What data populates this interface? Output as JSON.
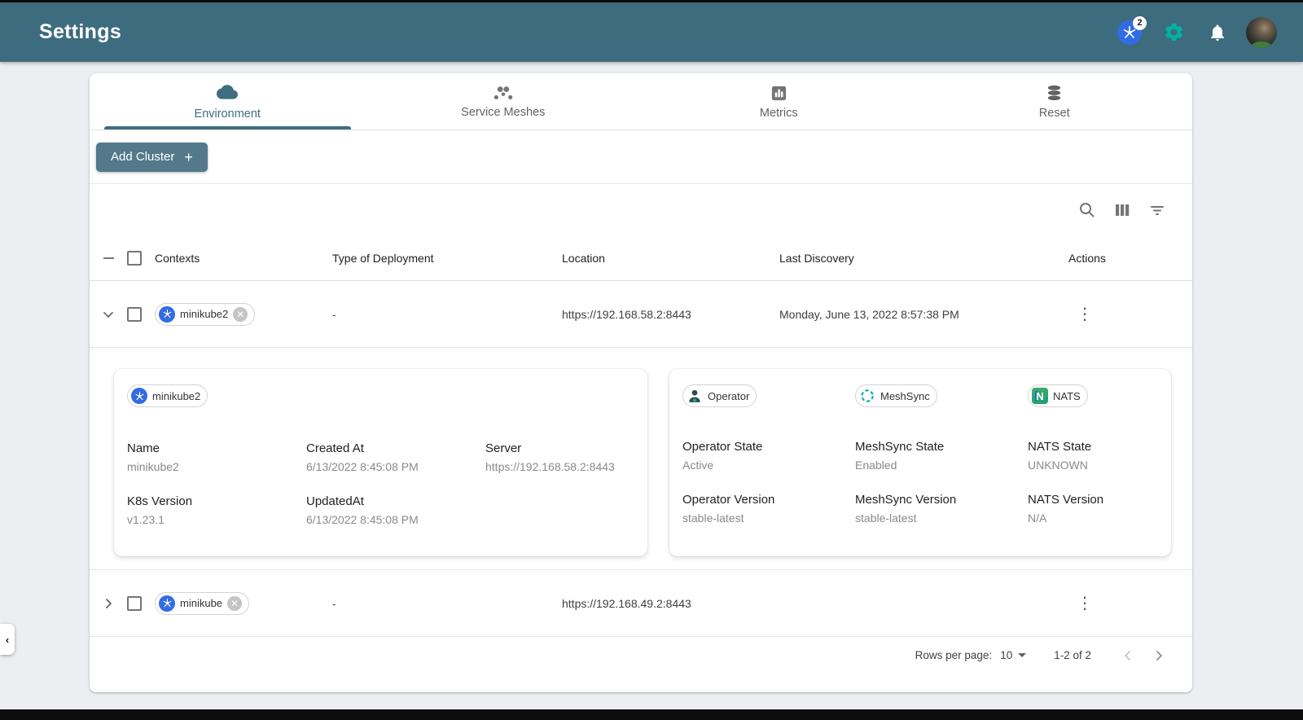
{
  "header": {
    "title": "Settings",
    "kubernetes_badge": "2"
  },
  "tabs": {
    "environment": "Environment",
    "service_meshes": "Service Meshes",
    "metrics": "Metrics",
    "reset": "Reset"
  },
  "actions": {
    "add_cluster": "Add Cluster",
    "plus": "+"
  },
  "icons": {
    "more_vertical": "⋮",
    "drawer_collapse": "‹"
  },
  "table": {
    "columns": {
      "contexts": "Contexts",
      "type": "Type of Deployment",
      "location": "Location",
      "last_discovery": "Last Discovery",
      "actions": "Actions"
    },
    "rows": [
      {
        "context": "minikube2",
        "type": "-",
        "location": "https://192.168.58.2:8443",
        "last_discovery": "Monday, June 13, 2022 8:57:38 PM"
      },
      {
        "context": "minikube",
        "type": "-",
        "location": "https://192.168.49.2:8443"
      }
    ]
  },
  "cluster_card": {
    "chip": "minikube2",
    "name_label": "Name",
    "name": "minikube2",
    "created_label": "Created At",
    "created": "6/13/2022 8:45:08 PM",
    "server_label": "Server",
    "server": "https://192.168.58.2:8443",
    "k8s_label": "K8s Version",
    "k8s": "v1.23.1",
    "updated_label": "UpdatedAt",
    "updated": "6/13/2022 8:45:08 PM"
  },
  "operator_card": {
    "operator_chip": "Operator",
    "meshsync_chip": "MeshSync",
    "nats_chip": "NATS",
    "nats_letter": "N",
    "operator_state_label": "Operator State",
    "operator_state": "Active",
    "meshsync_state_label": "MeshSync State",
    "meshsync_state": "Enabled",
    "nats_state_label": "NATS State",
    "nats_state": "UNKNOWN",
    "operator_version_label": "Operator Version",
    "operator_version": "stable-latest",
    "meshsync_version_label": "MeshSync Version",
    "meshsync_version": "stable-latest",
    "nats_version_label": "NATS Version",
    "nats_version": "N/A"
  },
  "pagination": {
    "rows_per_page_label": "Rows per page:",
    "rows_per_page": "10",
    "range": "1-2 of 2"
  },
  "colors": {
    "header_bg": "#3d6c7e",
    "button_bg": "#53798b",
    "tab_active": "#3e6e80",
    "accent_green": "#00B39F",
    "kubernetes_blue": "#326CE5"
  }
}
